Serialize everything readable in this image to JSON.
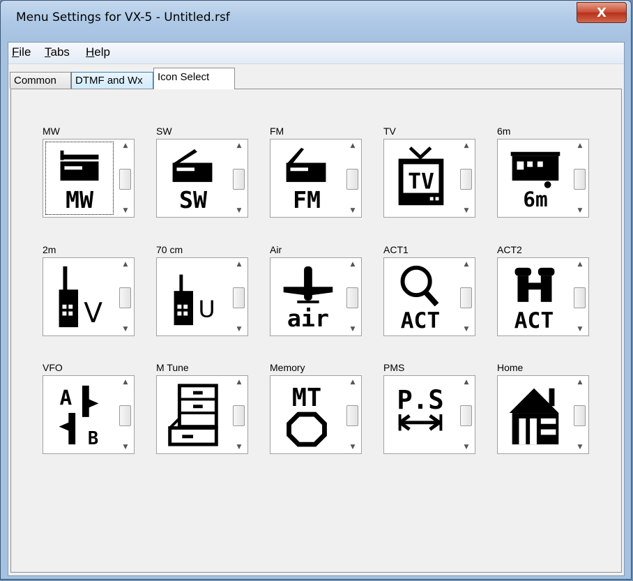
{
  "window": {
    "title": "Menu Settings for VX-5 - Untitled.rsf",
    "close_label": "X"
  },
  "menu": [
    {
      "mnemonic": "F",
      "rest": "ile"
    },
    {
      "mnemonic": "T",
      "rest": "abs"
    },
    {
      "mnemonic": "H",
      "rest": "elp"
    }
  ],
  "tabs": [
    "Common",
    "DTMF and Wx",
    "Icon Select"
  ],
  "active_tab": "Icon Select",
  "icons": [
    {
      "label": "MW",
      "icon": "radio-mw-icon",
      "text": "MW"
    },
    {
      "label": "SW",
      "icon": "radio-sw-icon",
      "text": "SW"
    },
    {
      "label": "FM",
      "icon": "radio-fm-icon",
      "text": "FM"
    },
    {
      "label": "TV",
      "icon": "tv-icon",
      "text": "TV"
    },
    {
      "label": "6m",
      "icon": "radio-6m-icon",
      "text": "6m"
    },
    {
      "label": "2m",
      "icon": "handheld-v-icon",
      "text": "V"
    },
    {
      "label": "70 cm",
      "icon": "handheld-u-icon",
      "text": "U"
    },
    {
      "label": "Air",
      "icon": "airplane-icon",
      "text": "air"
    },
    {
      "label": "ACT1",
      "icon": "magnifier-act-icon",
      "text": "ACT"
    },
    {
      "label": "ACT2",
      "icon": "binoculars-act-icon",
      "text": "ACT"
    },
    {
      "label": "VFO",
      "icon": "vfo-ab-icon",
      "text": "A B"
    },
    {
      "label": "M Tune",
      "icon": "drawer-icon",
      "text": ""
    },
    {
      "label": "Memory",
      "icon": "memory-mt-icon",
      "text": "MT"
    },
    {
      "label": "PMS",
      "icon": "pms-icon",
      "text": "P.S"
    },
    {
      "label": "Home",
      "icon": "house-icon",
      "text": ""
    }
  ],
  "colors": {
    "titlebar": "#aec9e6",
    "close": "#c84a2f",
    "tab_hover": "#d0ebfb"
  }
}
